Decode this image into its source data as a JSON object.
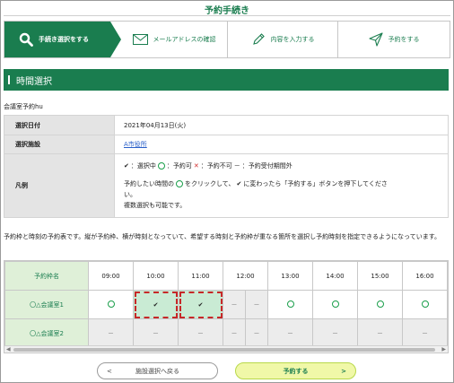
{
  "header": {
    "title": "予約手続き"
  },
  "steps": [
    {
      "label": "手続き選択をする",
      "icon": "search-icon",
      "active": true
    },
    {
      "label": "メールアドレスの確認",
      "icon": "mail-icon",
      "active": false
    },
    {
      "label": "内容を入力する",
      "icon": "pencil-icon",
      "active": false
    },
    {
      "label": "予約をする",
      "icon": "send-icon",
      "active": false
    }
  ],
  "section": {
    "title": "時間選択"
  },
  "facility": {
    "name": "会議室予約hu"
  },
  "info": {
    "date_label": "選択日付",
    "date_value": "2021年04月13日(火)",
    "facility_label": "選択施設",
    "facility_link": "A市役所",
    "legend_label": "凡例",
    "legend_selected": "：選択中",
    "legend_available": "：予約可",
    "legend_unavailable": "：予約不可",
    "legend_outside_mark": "－",
    "legend_outside": "：予約受付期間外",
    "legend_note_1a": "予約したい時間の",
    "legend_note_1b": "をクリックして、",
    "legend_note_1c": "に変わったら「予約する」ボタンを押下してくださ",
    "legend_note_2": "い。",
    "legend_note_3": "複数選択も可能です。"
  },
  "description": "予約枠と時刻の予約表です。縦が予約枠、横が時刻となっていて、希望する時刻と予約枠が重なる箇所を選択し予約時刻を指定できるようになっています。",
  "schedule": {
    "name_header": "予約枠名",
    "times": [
      "09:00",
      "10:00",
      "11:00",
      "12:00",
      "13:00",
      "14:00",
      "15:00",
      "16:00"
    ],
    "rows": [
      {
        "name": "〇△会議室1",
        "cells": [
          "available",
          "selected",
          "selected",
          "outside",
          "outside",
          "available",
          "available",
          "available",
          "available"
        ]
      },
      {
        "name": "〇△会議室2",
        "cells": [
          "outside",
          "outside",
          "outside",
          "outside",
          "outside",
          "outside",
          "outside",
          "outside",
          "outside"
        ]
      }
    ],
    "outside_mark": "－",
    "selected_mark": "✔"
  },
  "buttons": {
    "back_label": "施設選択へ戻る",
    "next_label": "予約する"
  },
  "colors": {
    "brand_green": "#1a7d4f",
    "selected_bg": "#c9ebd4",
    "selected_border": "#c62828",
    "circle_green": "#1a9e4a",
    "next_button_bg": "#f0f8a8"
  }
}
